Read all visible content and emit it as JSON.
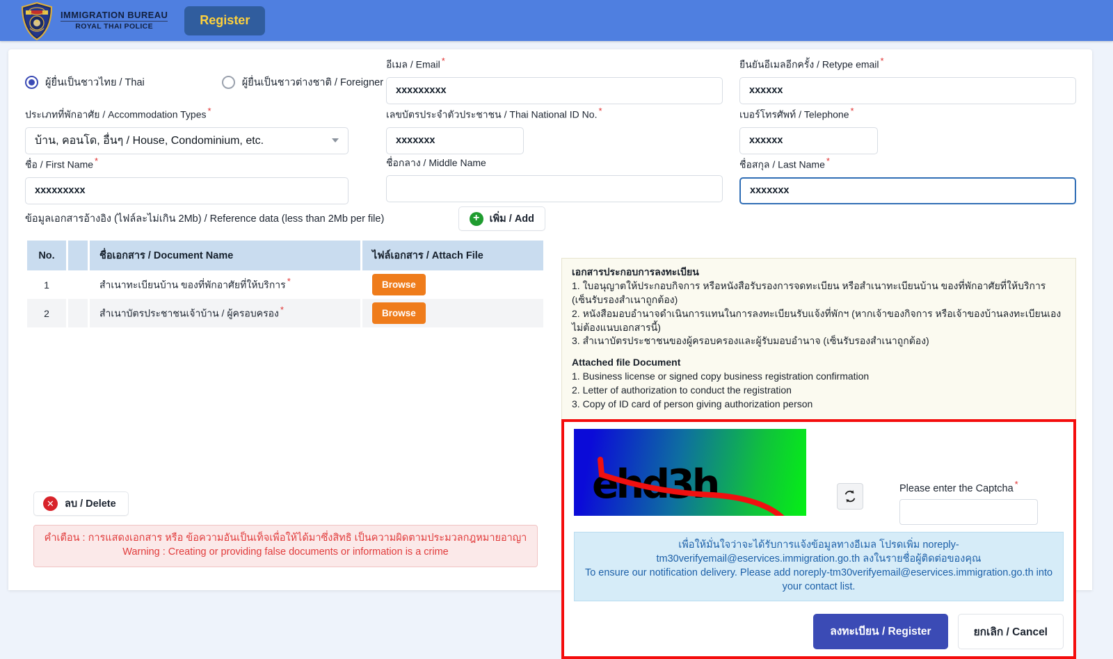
{
  "header": {
    "brand_line1": "IMMIGRATION BUREAU",
    "brand_line2": "ROYAL THAI POLICE",
    "crest_icon": "police-crest-icon",
    "register_tab": "Register",
    "bar_color": "#4f7fe0",
    "tab_color": "#305d9e",
    "tab_text_color": "#ffd23c"
  },
  "applicant_type": {
    "thai": "ผู้ยื่นเป็นชาวไทย / Thai",
    "foreigner": "ผู้ยื่นเป็นชาวต่างชาติ / Foreigner",
    "selected": "thai"
  },
  "fields": {
    "accommodation": {
      "label": "ประเภทที่พักอาศัย / Accommodation Types",
      "value": "บ้าน, คอนโด, อื่นๆ / House, Condominium, etc.",
      "required": true
    },
    "first_name": {
      "label": "ชื่อ / First Name",
      "value": "xxxxxxxxx",
      "required": true
    },
    "email": {
      "label": "อีเมล / Email",
      "value": "xxxxxxxxx",
      "required": true
    },
    "national_id": {
      "label": "เลขบัตรประจำตัวประชาชน / Thai National ID No.",
      "value": "xxxxxxx",
      "required": true
    },
    "middle_name": {
      "label": "ชื่อกลาง / Middle Name",
      "value": "",
      "required": false
    },
    "retype_email": {
      "label": "ยืนยันอีเมลอีกครั้ง / Retype email",
      "value": "xxxxxx",
      "required": true
    },
    "telephone": {
      "label": "เบอร์โทรศัพท์ / Telephone",
      "value": "xxxxxx",
      "required": true
    },
    "last_name": {
      "label": "ชื่อสกุล / Last Name",
      "value": "xxxxxxx",
      "required": true,
      "focused": true
    }
  },
  "reference": {
    "title": "ข้อมูลเอกสารอ้างอิง (ไฟล์ละไม่เกิน 2Mb) / Reference data (less than 2Mb per file)",
    "add_label": "เพิ่ม / Add",
    "add_icon": "plus-circle-icon",
    "columns": [
      "No.",
      "ชื่อเอกสาร / Document Name",
      "ไฟล์เอกสาร / Attach File"
    ],
    "rows": [
      {
        "no": "1",
        "name": "สำเนาทะเบียนบ้าน ของที่พักอาศัยที่ให้บริการ",
        "required": true,
        "browse": "Browse"
      },
      {
        "no": "2",
        "name": "สำเนาบัตรประชาชนเจ้าบ้าน / ผู้ครอบครอง",
        "required": true,
        "browse": "Browse"
      }
    ],
    "delete_label": "ลบ / Delete",
    "delete_icon": "x-circle-icon"
  },
  "warning": {
    "thai": "คำเตือน : การแสดงเอกสาร หรือ ข้อความอันเป็นเท็จเพื่อให้ได้มาซึ่งสิทธิ เป็นความผิดตามประมวลกฎหมายอาญา",
    "english": "Warning : Creating or providing false documents or information is a crime",
    "color": "#e13b3b"
  },
  "info_panel": {
    "thai_heading": "เอกสารประกอบการลงทะเบียน",
    "thai_items": [
      "1. ใบอนุญาตให้ประกอบกิจการ หรือหนังสือรับรองการจดทะเบียน หรือสำเนาทะเบียนบ้าน ของที่พักอาศัยที่ให้บริการ (เซ็นรับรองสำเนาถูกต้อง)",
      "2. หนังสือมอบอำนาจดำเนินการแทนในการลงทะเบียนรับแจ้งที่พักฯ (หากเจ้าของกิจการ หรือเจ้าของบ้านลงทะเบียนเอง ไม่ต้องแนบเอกสารนี้)",
      "3. สำเนาบัตรประชาชนของผู้ครอบครองและผู้รับมอบอำนาจ (เซ็นรับรองสำเนาถูกต้อง)"
    ],
    "english_heading": "Attached file Document",
    "english_items": [
      "1. Business license or signed copy business registration confirmation",
      "2. Letter of authorization to conduct the registration",
      "3. Copy of ID card of person giving authorization person"
    ]
  },
  "captcha": {
    "image_text": "ehd3h",
    "refresh_icon": "refresh-icon",
    "input_label": "Please enter the Captcha",
    "input_value": "",
    "required": true,
    "border_color": "#f40d0d"
  },
  "email_note": {
    "thai": "เพื่อให้มั่นใจว่าจะได้รับการแจ้งข้อมูลทางอีเมล โปรดเพิ่ม noreply-tm30verifyemail@eservices.immigration.go.th ลงในรายชื่อผู้ติดต่อของคุณ",
    "english": "To ensure our notification delivery. Please add noreply-tm30verifyemail@eservices.immigration.go.th into your contact list.",
    "color": "#1b5fa8"
  },
  "actions": {
    "register": "ลงทะเบียน / Register",
    "cancel": "ยกเลิก / Cancel",
    "register_color": "#3b4bb5"
  }
}
